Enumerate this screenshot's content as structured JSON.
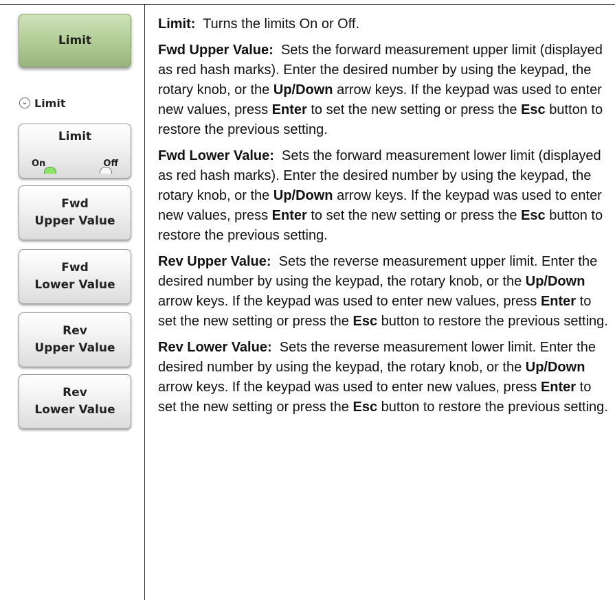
{
  "menu": {
    "main_button_label": "Limit",
    "title": "Limit",
    "buttons": [
      {
        "label_line1": "Limit",
        "toggle_on": "On",
        "toggle_off": "Off",
        "state": "On"
      },
      {
        "label_line1": "Fwd",
        "label_line2": "Upper Value"
      },
      {
        "label_line1": "Fwd",
        "label_line2": "Lower Value"
      },
      {
        "label_line1": "Rev",
        "label_line2": "Upper Value"
      },
      {
        "label_line1": "Rev",
        "label_line2": "Lower Value"
      }
    ]
  },
  "colors": {
    "main_button": "#b3cd97",
    "toggle_on_indicator": "#8ee46a"
  },
  "descriptions": [
    {
      "term": "Limit:",
      "text": "Turns the limits On or Off."
    },
    {
      "term": "Fwd Upper Value:",
      "text1": "Sets the forward measurement upper limit (displayed as red hash marks). Enter the desired number by using the keypad, the rotary knob, or the",
      "key1": "Up/Down",
      "text2": "arrow keys. If the keypad was used to enter new values, press",
      "key2": "Enter",
      "text3": "to set the new setting or press the",
      "key3": "Esc",
      "text4": "button to restore the previous setting."
    },
    {
      "term": "Fwd Lower Value:",
      "text1": "Sets the forward measurement lower limit (displayed as red hash marks). Enter the desired number by using the keypad, the rotary knob, or the",
      "key1": "Up/Down",
      "text2": "arrow keys. If the keypad was used to enter new values, press",
      "key2": "Enter",
      "text3": "to set the new setting or press the",
      "key3": "Esc",
      "text4": "button to restore the previous setting."
    },
    {
      "term": "Rev Upper Value:",
      "text1": "Sets the reverse measurement upper limit. Enter the desired number by using the keypad, the rotary knob, or the",
      "key1": "Up/Down",
      "text2": "arrow keys. If the keypad was used to enter new values, press",
      "key2": "Enter",
      "text3": "to set the new setting or press the",
      "key3": "Esc",
      "text4": "button to restore the previous setting."
    },
    {
      "term": "Rev Lower Value:",
      "text1": "Sets the reverse measurement lower limit. Enter the desired number by using the keypad, the rotary knob, or the",
      "key1": "Up/Down",
      "text2": "arrow keys. If the keypad was used to enter new values, press",
      "key2": "Enter",
      "text3": "to set the new setting or press the",
      "key3": "Esc",
      "text4": "button to restore the previous setting."
    }
  ]
}
